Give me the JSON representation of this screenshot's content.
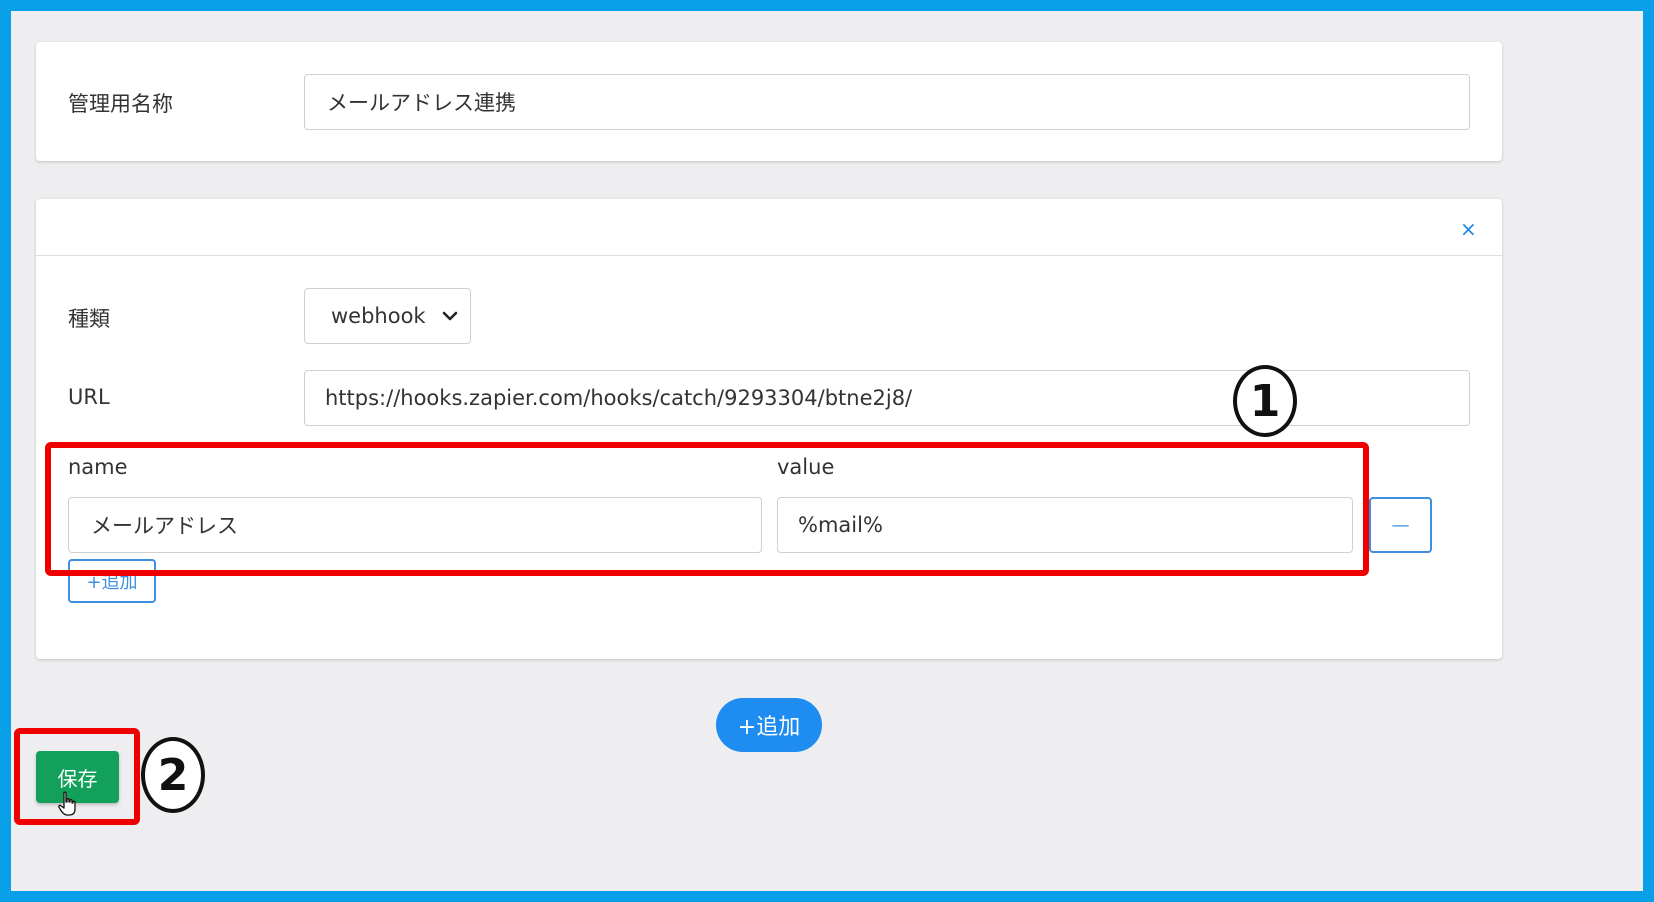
{
  "name_card": {
    "label": "管理用名称",
    "value": "メールアドレス連携"
  },
  "webhook_card": {
    "close_glyph": "×",
    "type_label": "種類",
    "type_selected": "webhook",
    "url_label": "URL",
    "url_value": "https://hooks.zapier.com/hooks/catch/9293304/btne2j8/",
    "param_name_header": "name",
    "param_value_header": "value",
    "param_rows": [
      {
        "name": "メールアドレス",
        "value": "%mail%",
        "remove_label": "—"
      }
    ],
    "add_param_label": "+追加"
  },
  "add_button_label": "+追加",
  "save_button_label": "保存",
  "annotations": {
    "step1": "1",
    "step2": "2",
    "highlight_color": "#ee0000"
  },
  "colors": {
    "frame": "#0aa0e8",
    "accent_blue": "#1e8cf0",
    "save_green": "#13a05a"
  },
  "icons": {
    "close": "close-icon",
    "dropdown": "chevron-down-icon",
    "cursor": "hand-pointer-icon"
  }
}
